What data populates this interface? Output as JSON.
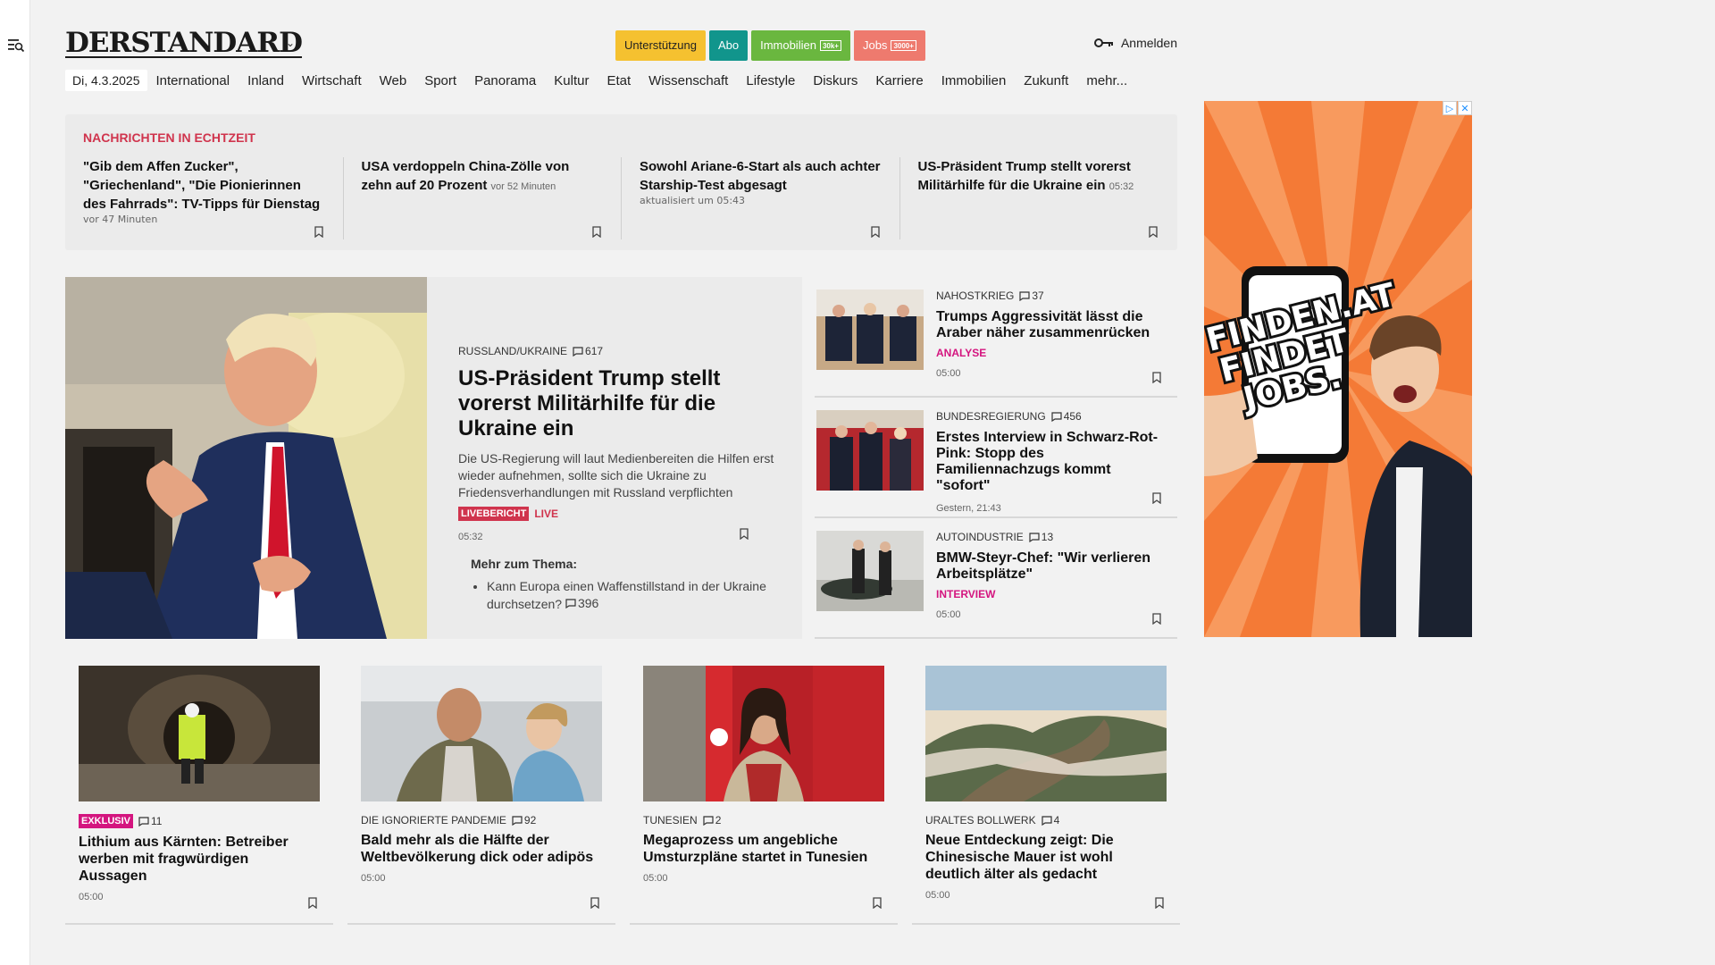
{
  "sidebar": {
    "menu_icon": "search-menu-icon"
  },
  "header": {
    "logo": "DERSTANDARD",
    "pills": [
      {
        "label": "Unterstützung",
        "bg": "#f5c130",
        "fg": "#222",
        "tag": ""
      },
      {
        "label": "Abo",
        "bg": "#11958c",
        "fg": "#fff",
        "tag": ""
      },
      {
        "label": "Immobilien",
        "bg": "#6ab73f",
        "fg": "#fff",
        "tag": "30k+"
      },
      {
        "label": "Jobs",
        "bg": "#ee7a6e",
        "fg": "#fff",
        "tag": "3000+"
      }
    ],
    "login": "Anmelden"
  },
  "nav": {
    "date": "Di, 4.3.2025",
    "items": [
      "International",
      "Inland",
      "Wirtschaft",
      "Web",
      "Sport",
      "Panorama",
      "Kultur",
      "Etat",
      "Wissenschaft",
      "Lifestyle",
      "Diskurs",
      "Karriere",
      "Immobilien",
      "Zukunft",
      "mehr..."
    ]
  },
  "ticker": {
    "title": "NACHRICHTEN IN ECHTZEIT",
    "items": [
      {
        "title": "\"Gib dem Affen Zucker\", \"Griechenland\", \"Die Pionierinnen des Fahrrads\": TV-Tipps für Dienstag",
        "meta": "vor 47 Minuten"
      },
      {
        "title": "USA verdoppeln China-Zölle von zehn auf 20 Prozent",
        "meta": "vor 52 Minuten"
      },
      {
        "title": "Sowohl Ariane-6-Start als auch achter Starship-Test abgesagt",
        "meta": "aktualisiert um 05:43"
      },
      {
        "title": "US-Präsident Trump stellt vorerst Militärhilfe für die Ukraine ein",
        "meta": "05:32"
      }
    ]
  },
  "lead": {
    "kicker": "RUSSLAND/UKRAINE",
    "comments": "617",
    "title": "US-Präsident Trump stellt vorerst Militärhilfe für die Ukraine ein",
    "text": "Die US-Regierung will laut Medienbereiten die Hilfen erst wieder aufnehmen, sollte sich die Ukraine zu Friedensverhandlungen mit Russland verpflichten",
    "badge": "LIVEBERICHT",
    "live": "LIVE",
    "time": "05:32",
    "more_heading": "Mehr zum Thema:",
    "more_item": "Kann Europa einen Waffenstillstand in der Ukraine durchsetzen?",
    "more_comments": "396"
  },
  "side": [
    {
      "kicker": "NAHOSTKRIEG",
      "comments": "37",
      "title": "Trumps Aggressivität lässt die Araber näher zusammenrücken",
      "label": "ANALYSE",
      "time": "05:00"
    },
    {
      "kicker": "BUNDESREGIERUNG",
      "comments": "456",
      "title": "Erstes Interview in Schwarz-Rot-Pink: Stopp des Familiennachzugs kommt \"sofort\"",
      "label": "",
      "time": "Gestern, 21:43"
    },
    {
      "kicker": "AUTOINDUSTRIE",
      "comments": "13",
      "title": "BMW-Steyr-Chef: \"Wir verlieren Arbeitsplätze\"",
      "label": "INTERVIEW",
      "time": "05:00"
    }
  ],
  "ad": {
    "text": "FINDEN.AT FINDET JOBS."
  },
  "cards": [
    {
      "badge": "EXKLUSIV",
      "kicker": "",
      "comments": "11",
      "title": "Lithium aus Kärnten: Betreiber werben mit fragwürdigen Aussagen",
      "time": "05:00"
    },
    {
      "badge": "",
      "kicker": "DIE IGNORIERTE PANDEMIE",
      "comments": "92",
      "title": "Bald mehr als die Hälfte der Weltbevölkerung dick oder adipös",
      "time": "05:00"
    },
    {
      "badge": "",
      "kicker": "TUNESIEN",
      "comments": "2",
      "title": "Megaprozess um angebliche Umsturzpläne startet in Tunesien",
      "time": "05:00"
    },
    {
      "badge": "",
      "kicker": "URALTES BOLLWERK",
      "comments": "4",
      "title": "Neue Entdeckung zeigt: Die Chinesische Mauer ist wohl deutlich älter als gedacht",
      "time": "05:00"
    }
  ]
}
